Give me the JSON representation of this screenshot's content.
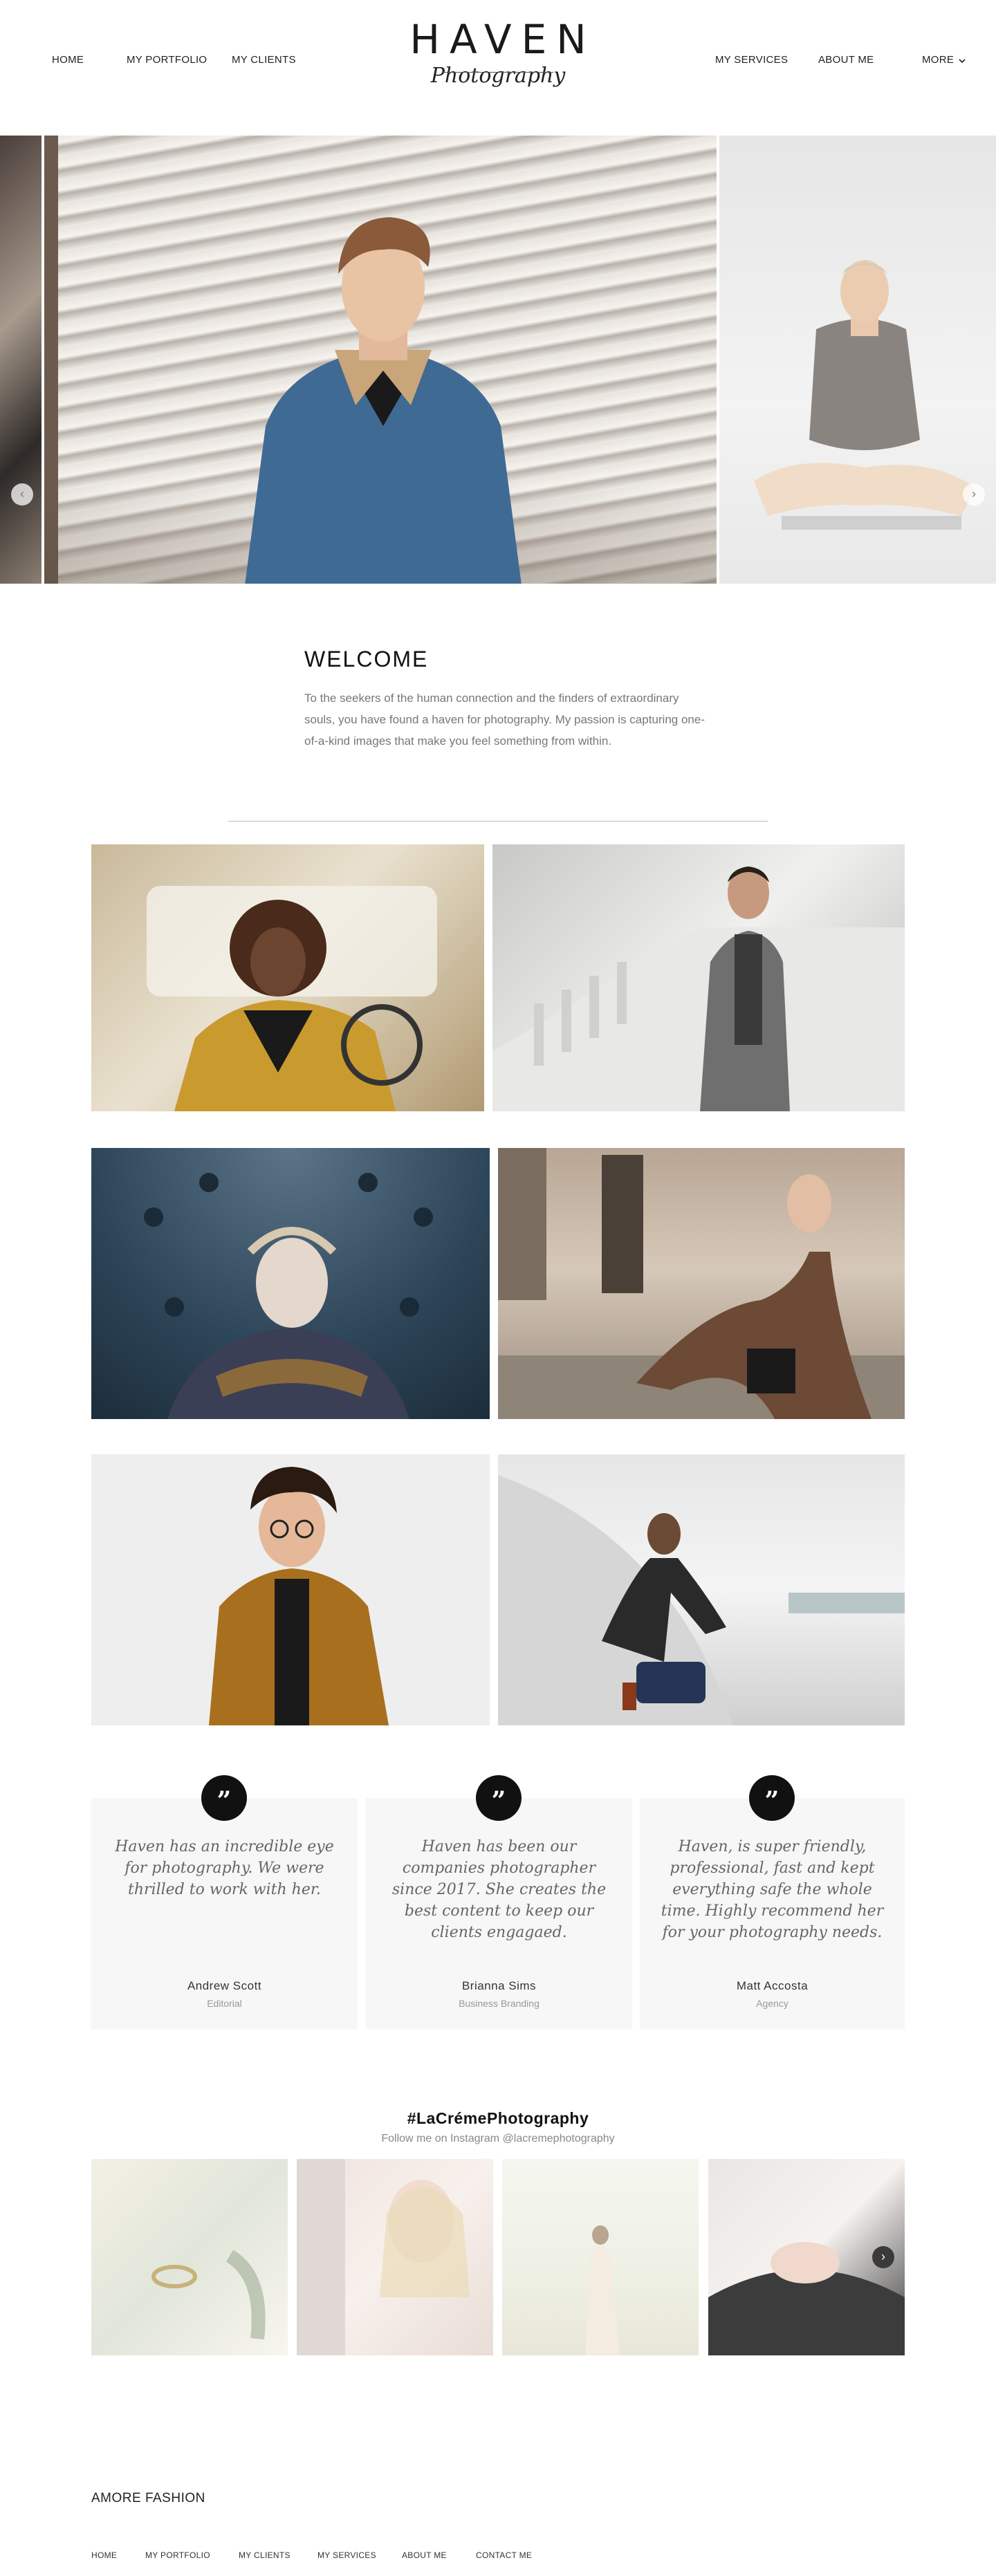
{
  "header": {
    "nav_left": [
      "HOME",
      "MY PORTFOLIO",
      "MY CLIENTS"
    ],
    "nav_right": [
      "MY SERVICES",
      "ABOUT ME",
      "MORE"
    ],
    "more_icon": "chevron-down-icon",
    "logo_main": "HAVEN",
    "logo_script": "Photography"
  },
  "slider": {
    "prev_icon": "chevron-left-icon",
    "next_icon": "chevron-right-icon"
  },
  "welcome": {
    "title": "WELCOME",
    "body": "To the seekers of the human connection and the finders of extraordinary souls, you have found a haven for photography. My passion is capturing one-of-a-kind images that make you feel something from within."
  },
  "testimonials": [
    {
      "quote": "Haven has an incredible eye for photography. We were thrilled to work with her.",
      "name": "Andrew Scott",
      "role": "Editorial"
    },
    {
      "quote": "Haven has been our companies photographer since 2017. She creates the best content to keep our clients engagaed.",
      "name": "Brianna Sims",
      "role": "Business Branding"
    },
    {
      "quote": "Haven, is super friendly, professional, fast and kept everything safe the whole time. Highly recommend her for your photography needs.",
      "name": "Matt Accosta",
      "role": "Agency"
    }
  ],
  "instagram": {
    "title": "#LaCrémePhotography",
    "subtitle": "Follow me on Instagram @lacremephotography",
    "next_icon": "chevron-right-icon"
  },
  "footer": {
    "brand": "AMORE FASHION",
    "links": [
      "HOME",
      "MY PORTFOLIO",
      "MY CLIENTS",
      "MY SERVICES",
      "ABOUT ME",
      "CONTACT ME"
    ]
  },
  "colors": {
    "text": "#222222",
    "muted": "#777777",
    "card_bg": "#f7f7f7",
    "quote_badge": "#111111"
  }
}
